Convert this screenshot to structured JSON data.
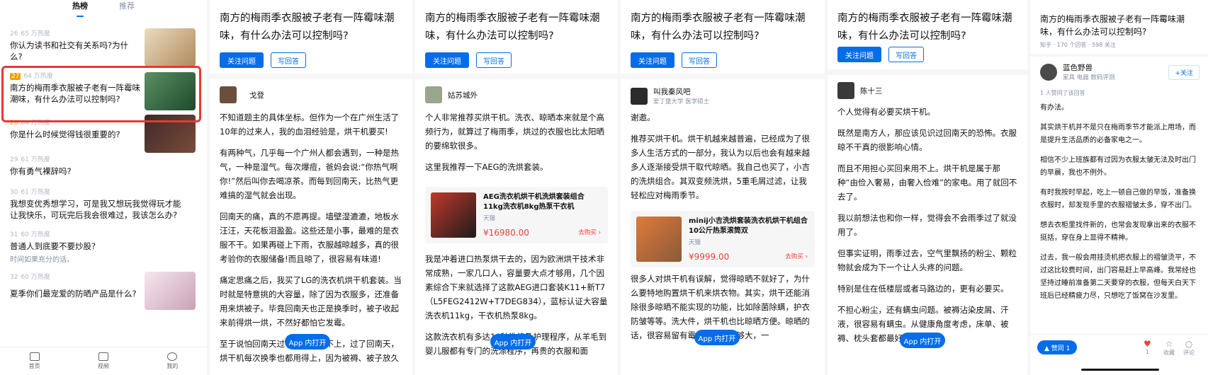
{
  "feed": {
    "tabs": [
      "热榜",
      "推荐"
    ],
    "items": [
      {
        "rank": "26",
        "heat": "65 万热度",
        "title": "你认为读书和社交有关系吗?为什么?",
        "excerpt": ""
      },
      {
        "rank": "27",
        "heat": "64 万热度",
        "title": "南方的梅雨季衣服被子老有一阵霉味潮味，有什么办法可以控制吗?",
        "excerpt": ""
      },
      {
        "rank": "28",
        "heat": "64 万热度",
        "title": "你是什么时候觉得钱很重要的?",
        "excerpt": ""
      },
      {
        "rank": "29",
        "heat": "61 万热度",
        "title": "你有勇气裸辞吗?",
        "excerpt": ""
      },
      {
        "rank": "30",
        "heat": "61 万热度",
        "title": "我想变优秀想学习，可是我又想玩我觉得玩才能让我快乐，可玩完后我会很难过，我该怎么办?",
        "excerpt": ""
      },
      {
        "rank": "31",
        "heat": "60 万热度",
        "title": "普通人到底要不要炒股?",
        "excerpt": "时间如果充分的话。"
      },
      {
        "rank": "32",
        "heat": "60 万热度",
        "title": "夏季你们最宠爱的防晒产品是什么?",
        "excerpt": ""
      }
    ],
    "nav": [
      "首页",
      "视频",
      "我的"
    ]
  },
  "question": {
    "title": "南方的梅雨季衣服被子老有一阵霉味潮味，有什么办法可以控制吗?",
    "follow": "关注问题",
    "answer": "写回答",
    "app_open": "App 内打开"
  },
  "answers": [
    {
      "author": "戈登",
      "paragraphs": [
        "不知道题主的具体坐标。但作为一个在广州生活了10年的过来人，我的血泪经验是，烘干机要买!",
        "有两种气，几乎每一个广州人都会遇到，一种是热气，一种是湿气。每次爆痘，爸妈会说:“你热气啊你!”然后叫你去喝凉茶。而每到回南天，比热气更难搞的湿气就会出现。",
        "回南天的痛，真的不愿再提。墙壁湿漉漉，地板水汪汪，天花板泪盈盈。这些还是小事，最难的是衣服不干。如果再碰上下雨，衣服越晾越多，真的很考验你的衣服储备!而且晾了，很容易有味道!",
        "痛定思痛之后，我买了LG的洗衣机烘干机套装。当时就是特意挑的大容量，除了因为衣服多，还准备用来烘被子。毕竟回南天也正是换季时，被子收起来前得烘一烘，不然好都怕它发霉。",
        "至于说怕回南天过了就实际用不上，过了回南天，烘干机每次换季也都用得上，因为被褥、被子放久"
      ]
    },
    {
      "author": "姑苏城外",
      "paragraphs": [
        "个人非常推荐买烘干机。洗衣、晾晒本来就是个高频行为，就算过了梅雨季，烘过的衣服也比太阳晒的要绵软很多。",
        "这里我推荐一下AEG的洗烘套装。"
      ],
      "card": {
        "title": "AEG洗衣机烘干机洗烘套装组合11kg洗衣机8kg热泵干衣机",
        "shop": "天猫",
        "price": "¥16980.00",
        "buy": "去购买 ›"
      },
      "after": [
        "我是冲着进口热泵烘干去的，因为欧洲烘干技术非常成熟，一家几口人，容量要大点才够用，几个因素综合下来就选择了这款AEG进口套装K11+新T7（L5FEG2412W+T7DEG834），蓝标认证大容量洗衣机11kg，干衣机热泵8kg。",
        "这款洗衣机有多达16种洗涤及护理程序，从羊毛到婴儿服都有专门的洗涤程序，再贵的衣服和面"
      ]
    },
    {
      "author": "叫我秦风吧",
      "sub": "爱丁堡大学 医学硕士",
      "paragraphs": [
        "谢邀。",
        "推荐买烘干机。烘干机越来越普遍，已经成为了很多人生活方式的一部分，我认为以后也会有越来越多人逐渐接受烘干取代晾晒。我自己也买了，小吉的洗烘组合。其双变频洗烘，5重毛屑过滤，让我轻松应对梅雨季节。"
      ],
      "card": {
        "title": "minij小吉洗烘套装洗衣机烘干机组合10公斤热泵滚筒双",
        "shop": "天猫",
        "price": "¥9999.00",
        "buy": "去购买 ›"
      },
      "after": [
        "很多人对烘干机有误解，觉得晾晒不就好了，为什么要特地购置烘干机来烘衣物。其实，烘干还能消除很多晾晒不能实现的功能，比如除菌除螨，护衣防皱等等。洗大件，烘干机也比晾晒方便。晾晒的话，很容易留有霉气，太阳不够大，一"
      ]
    },
    {
      "author": "陈十三",
      "paragraphs": [
        "个人觉得有必要买烘干机。",
        "既然是南方人，那应该见识过回南天的恐怖。衣服晾不干真的很影响心情。",
        "而且不用担心买回来用不上。烘干机是属于那种“由俭入奢易，由奢入俭难”的家电。用了就回不去了。",
        "我以前想法也和你一样，觉得会不会雨季过了就没用了。",
        "但事实证明，雨季过去，空气里飘扬的粉尘、颗粒物就会成为下一个让人头疼的问题。",
        "特别是住在低楼层或者马路边的，更有必要买。",
        "不担心粉尘，还有螨虫问题。被褥沾染皮屑、汗液，很容易有螨虫。从健康角度考虑，床单、被褥、枕头套都最好定期烘烫。"
      ]
    },
    {
      "author": "蓝色野兽",
      "sub": "家具 电器 数码评测",
      "meta": "知乎 · 170 个回答 · 598 关注",
      "follow": "+关注",
      "liked": "1 人赞同了该回答",
      "paragraphs": [
        "有办法。",
        "其实烘干机并不是只在梅雨季节才能派上用场，而是提升生活品质的必备家电之一。",
        "相信不少上班族都有过因为衣服太皱无法及时出门的早晨，我也不例外。",
        "有时我按时早起，吃上一顿自己做的早饭，准备换衣服时，却发现手里的衣服褶皱太多，穿不出门。",
        "想去衣柜里找件新的，也常会发现拿出来的衣服不挺括，穿在身上显得不精神。",
        "过去，我一般会用挂烫机把衣服上的褶皱烫平，不过这比较费时间，出门容易赶上早高峰。我常经也坚持过睡前准备第二天要穿的衣服，但每天白天下班后已经精疲力尽，只想吃了饭窝在沙发里。"
      ],
      "agree": "▲ 赞同 1",
      "actions": [
        "1",
        "收藏",
        "评论"
      ]
    }
  ]
}
